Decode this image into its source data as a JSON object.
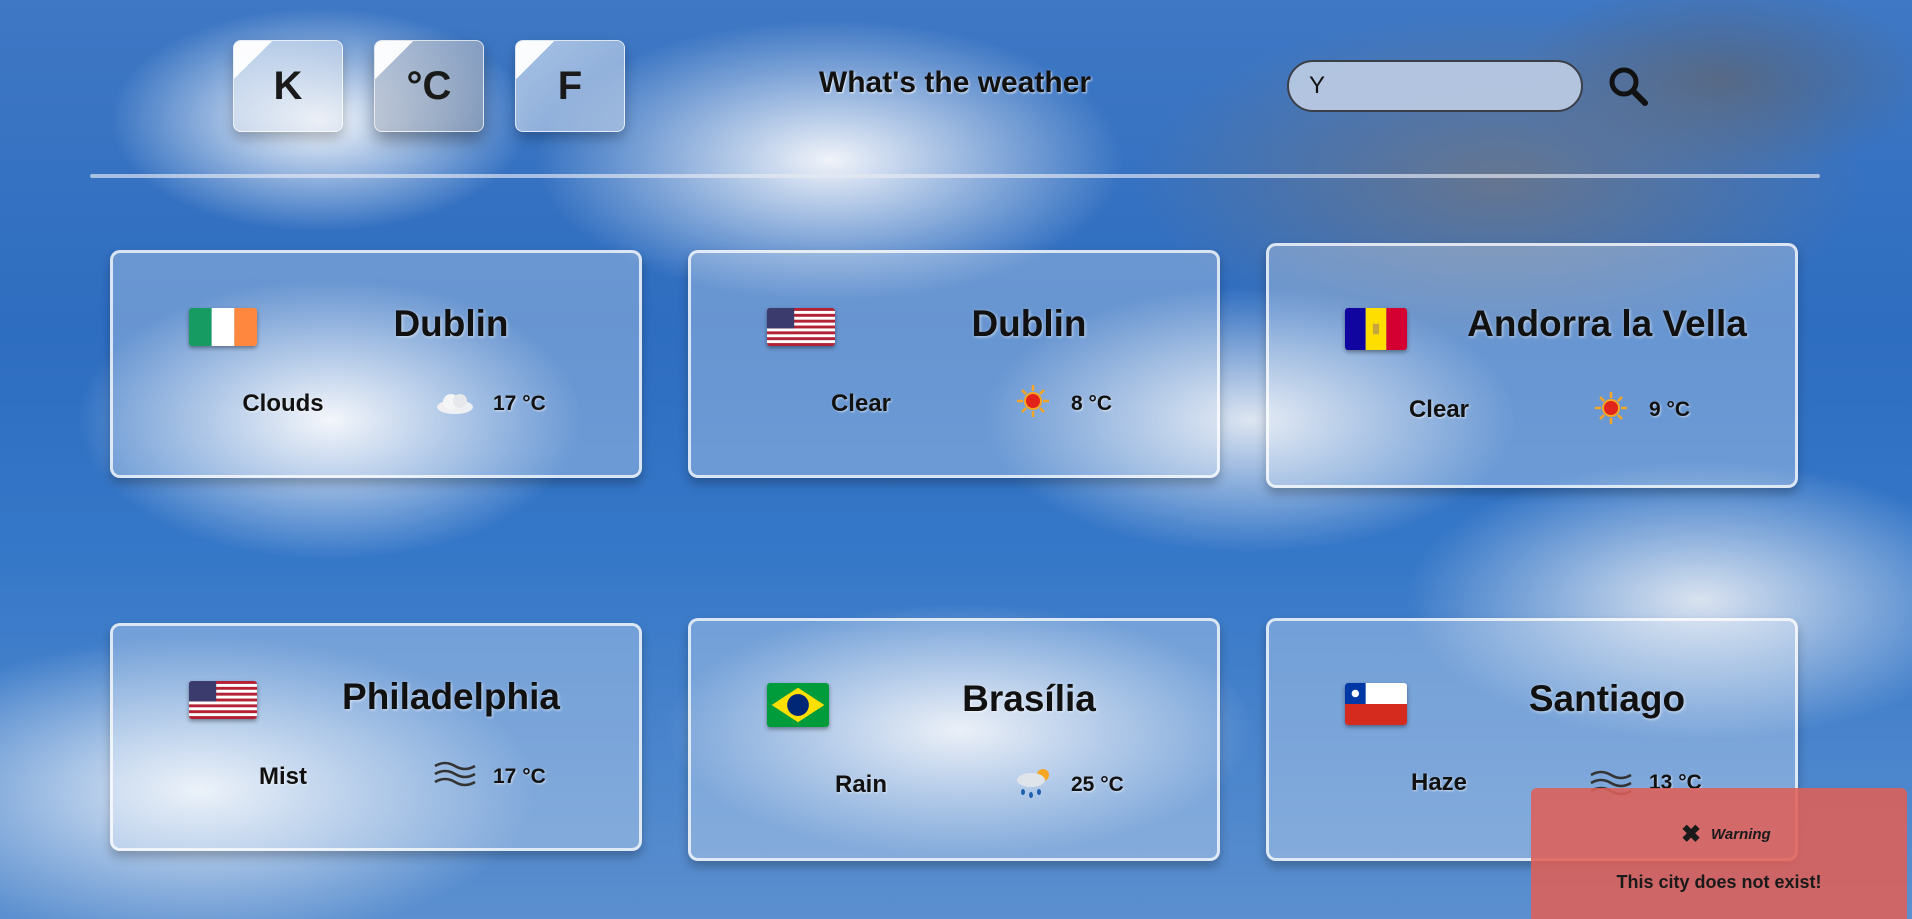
{
  "header": {
    "units": [
      {
        "label": "K",
        "active": false
      },
      {
        "label": "°C",
        "active": true
      },
      {
        "label": "F",
        "active": false
      }
    ],
    "title": "What's the weather",
    "search": {
      "value": "Y",
      "icon": "search-icon"
    }
  },
  "cards": [
    {
      "city": "Dublin",
      "country_flag": "ireland-flag",
      "description": "Clouds",
      "icon": "cloud-icon",
      "temp": "17 °C"
    },
    {
      "city": "Dublin",
      "country_flag": "usa-flag",
      "description": "Clear",
      "icon": "sun-icon",
      "temp": "8 °C"
    },
    {
      "city": "Andorra la Vella",
      "country_flag": "andorra-flag",
      "description": "Clear",
      "icon": "sun-icon",
      "temp": "9 °C"
    },
    {
      "city": "Philadelphia",
      "country_flag": "usa-flag",
      "description": "Mist",
      "icon": "mist-icon",
      "temp": "17 °C"
    },
    {
      "city": "Brasília",
      "country_flag": "brazil-flag",
      "description": "Rain",
      "icon": "rain-icon",
      "temp": "25 °C"
    },
    {
      "city": "Santiago",
      "country_flag": "chile-flag",
      "description": "Haze",
      "icon": "haze-icon",
      "temp": "13 °C"
    }
  ],
  "toast": {
    "icon": "close-icon",
    "title": "Warning",
    "message": "This city does not exist!",
    "color": "#de6058"
  }
}
